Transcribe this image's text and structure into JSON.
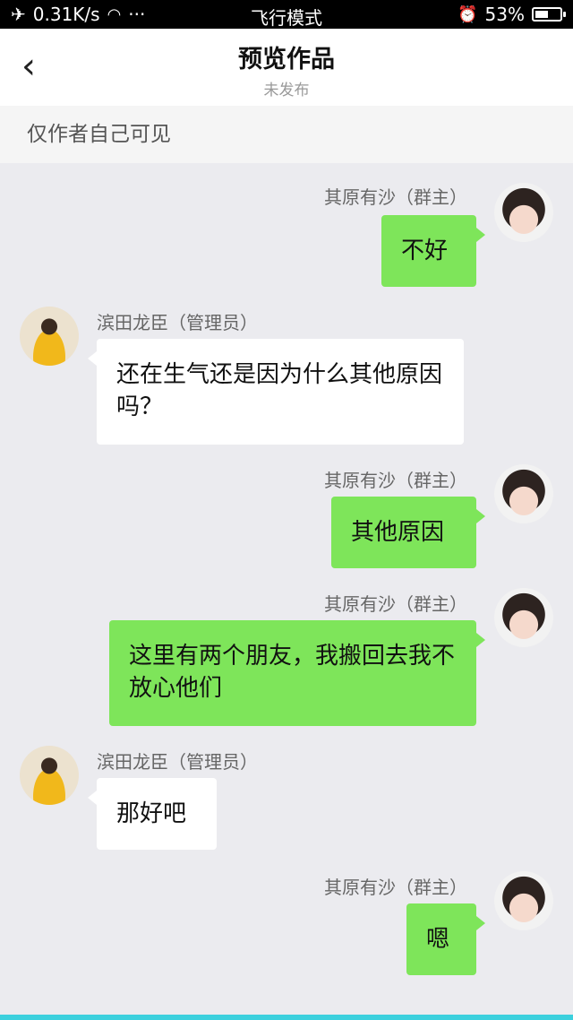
{
  "status_bar": {
    "speed": "0.31K/s",
    "more": "···",
    "mode": "飞行模式",
    "battery": "53%",
    "battery_level": 0.53
  },
  "nav": {
    "title": "预览作品",
    "subtitle": "未发布"
  },
  "notice": "仅作者自己可见",
  "messages": [
    {
      "sender": "其原有沙（群主）",
      "text": "不好",
      "outgoing": true
    },
    {
      "sender": "滨田龙臣（管理员）",
      "text": "还在生气还是因为什么其他原因吗？",
      "outgoing": false
    },
    {
      "sender": "其原有沙（群主）",
      "text": "其他原因",
      "outgoing": true
    },
    {
      "sender": "其原有沙（群主）",
      "text": "这里有两个朋友，我搬回去我不放心他们",
      "outgoing": true
    },
    {
      "sender": "滨田龙臣（管理员）",
      "text": "那好吧",
      "outgoing": false
    },
    {
      "sender": "其原有沙（群主）",
      "text": "嗯",
      "outgoing": true
    }
  ]
}
